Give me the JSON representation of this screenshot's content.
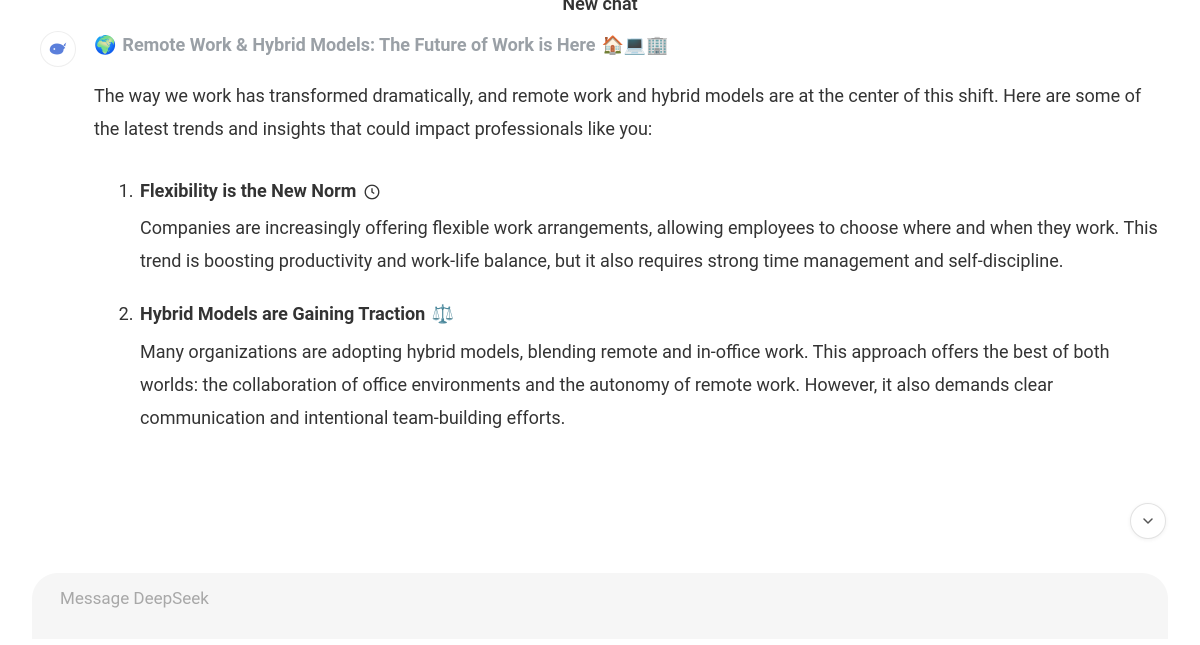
{
  "header": {
    "title": "New chat"
  },
  "message": {
    "heading_prefix_emoji": "🌍",
    "heading_text": "Remote Work & Hybrid Models: The Future of Work is Here",
    "heading_suffix_emojis": "🏠💻🏢",
    "intro": "The way we work has transformed dramatically, and remote work and hybrid models are at the center of this shift. Here are some of the latest trends and insights that could impact professionals like you:",
    "items": [
      {
        "title": "Flexibility is the New Norm",
        "title_emoji": "🕒",
        "body": "Companies are increasingly offering flexible work arrangements, allowing employees to choose where and when they work. This trend is boosting productivity and work-life balance, but it also requires strong time management and self-discipline."
      },
      {
        "title": "Hybrid Models are Gaining Traction",
        "title_emoji": "⚖️",
        "body": "Many organizations are adopting hybrid models, blending remote and in-office work. This approach offers the best of both worlds: the collaboration of office environments and the autonomy of remote work. However, it also demands clear communication and intentional team-building efforts."
      }
    ]
  },
  "input": {
    "placeholder": "Message DeepSeek"
  }
}
